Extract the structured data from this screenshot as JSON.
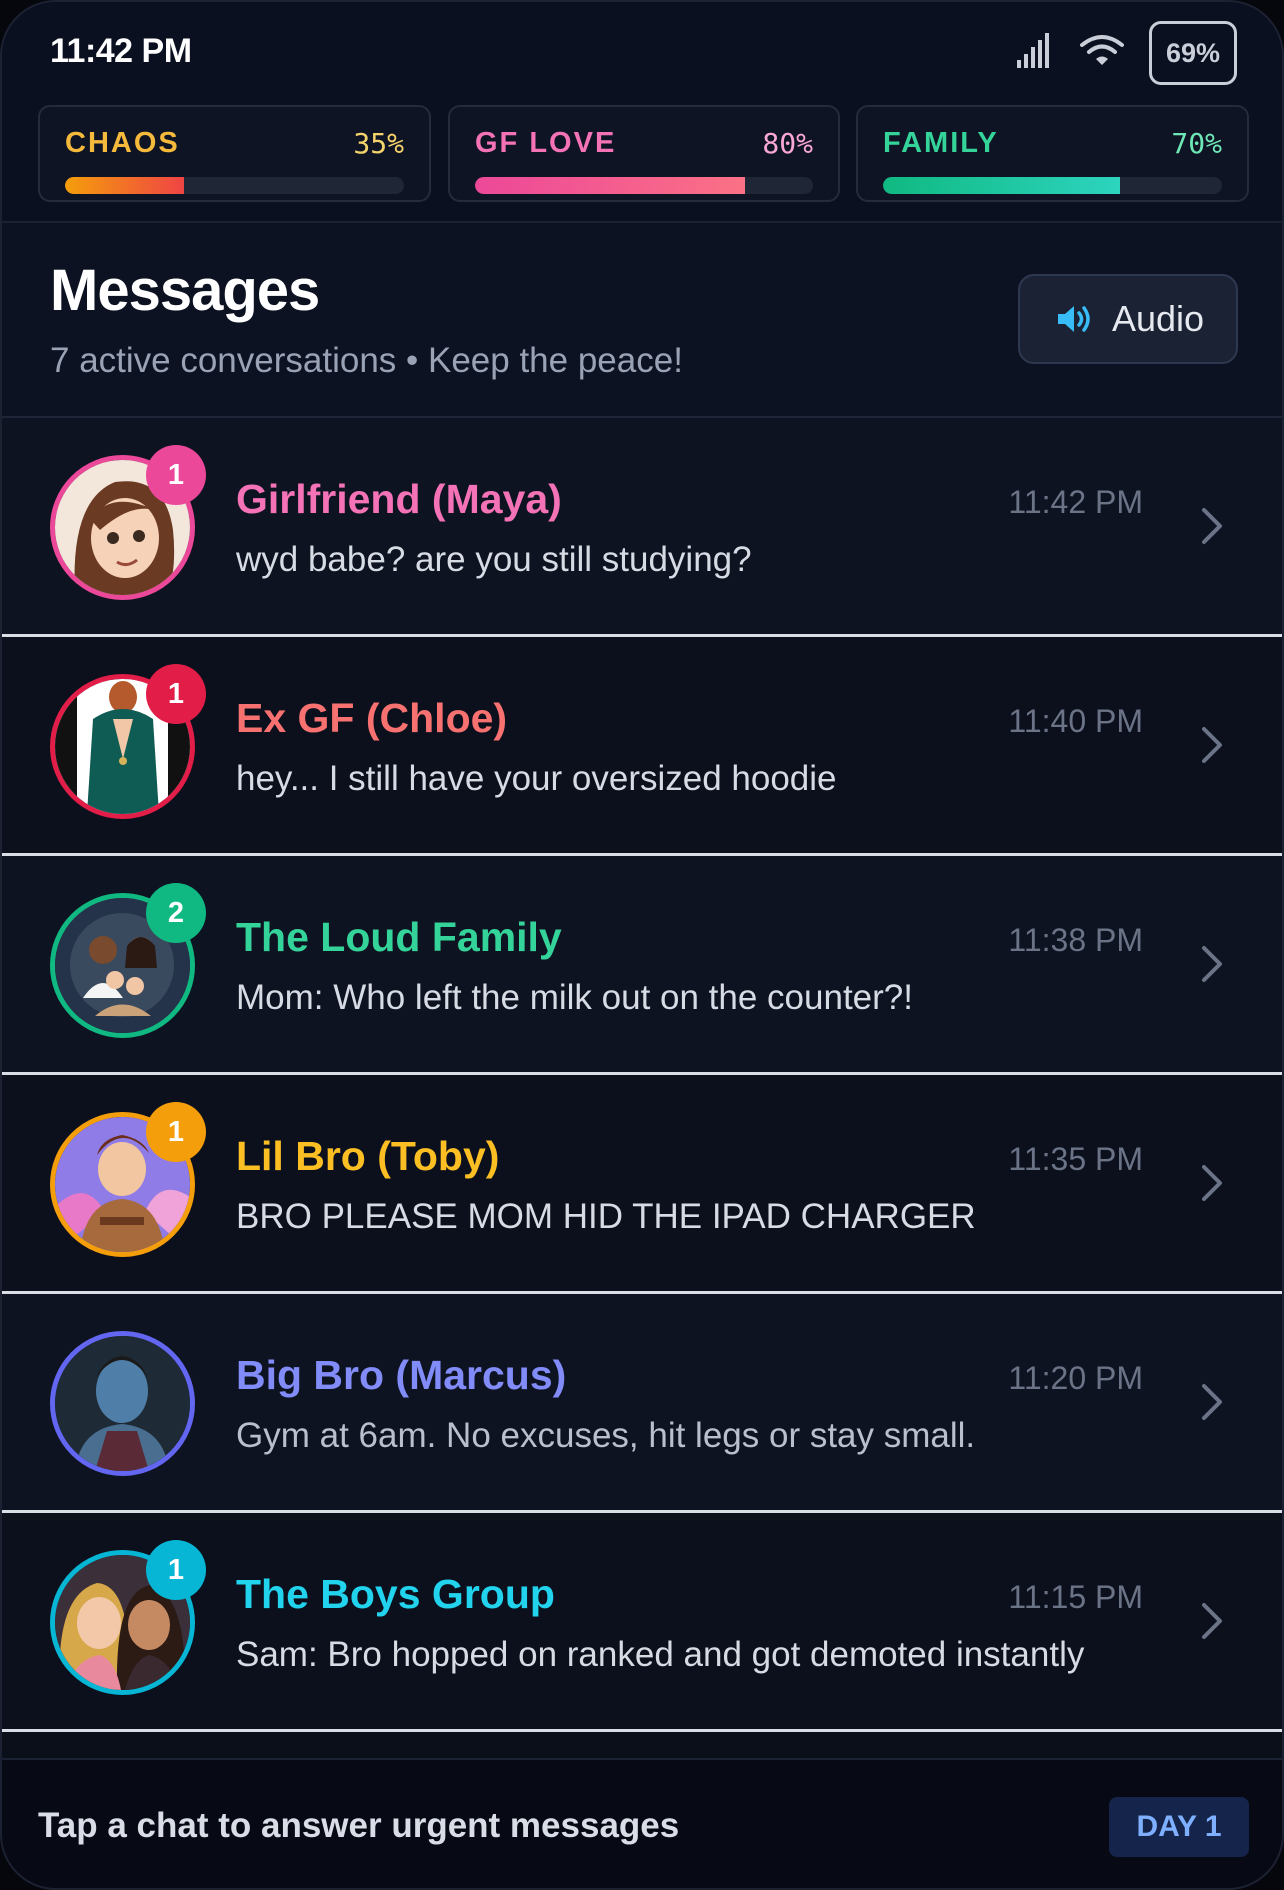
{
  "status_bar": {
    "time": "11:42 PM",
    "battery": "69%",
    "icons": [
      "signal-icon",
      "wifi-icon",
      "battery-icon"
    ]
  },
  "meters": [
    {
      "label": "CHAOS",
      "percent_text": "35%",
      "value": 35,
      "label_color": "#f5b93b",
      "pct_color": "#f5d36b",
      "fill": "linear-gradient(90deg,#f59e0b,#ef4444)"
    },
    {
      "label": "GF LOVE",
      "percent_text": "80%",
      "value": 80,
      "label_color": "#f472b6",
      "pct_color": "#f9a8d4",
      "fill": "linear-gradient(90deg,#ec4899,#fb7185)"
    },
    {
      "label": "FAMILY",
      "percent_text": "70%",
      "value": 70,
      "label_color": "#34d399",
      "pct_color": "#6ee7b7",
      "fill": "linear-gradient(90deg,#10b981,#2dd4bf)"
    }
  ],
  "header": {
    "title": "Messages",
    "subtitle": "7 active conversations • Keep the peace!",
    "audio_label": "Audio",
    "audio_icon": "speaker-icon"
  },
  "chats": [
    {
      "id": "girlfriend-maya",
      "name": "Girlfriend (Maya)",
      "time": "11:42 PM",
      "message": "wyd babe? are you still studying?",
      "badge": "1",
      "name_color": "#f472b6",
      "ring_color": "#ec4899",
      "badge_color": "#ec4899"
    },
    {
      "id": "ex-gf-chloe",
      "name": "Ex GF (Chloe)",
      "time": "11:40 PM",
      "message": "hey... I still have your oversized hoodie",
      "badge": "1",
      "name_color": "#f87171",
      "ring_color": "#e11d48",
      "badge_color": "#e11d48"
    },
    {
      "id": "loud-family",
      "name": "The Loud Family",
      "time": "11:38 PM",
      "message": "Mom: Who left the milk out on the counter?!",
      "badge": "2",
      "name_color": "#34d399",
      "ring_color": "#10b981",
      "badge_color": "#10b981"
    },
    {
      "id": "lil-bro-toby",
      "name": "Lil Bro (Toby)",
      "time": "11:35 PM",
      "message": "BRO PLEASE MOM HID THE IPAD CHARGER",
      "badge": "1",
      "name_color": "#fbbf24",
      "ring_color": "#f59e0b",
      "badge_color": "#f59e0b"
    },
    {
      "id": "big-bro-marcus",
      "name": "Big Bro (Marcus)",
      "time": "11:20 PM",
      "message": "Gym at 6am. No excuses, hit legs or stay small.",
      "badge": "",
      "name_color": "#818cf8",
      "ring_color": "#6366f1",
      "badge_color": "#6366f1"
    },
    {
      "id": "boys-group",
      "name": "The Boys Group",
      "time": "11:15 PM",
      "message": "Sam: Bro hopped on ranked and got demoted instantly",
      "badge": "1",
      "name_color": "#22d3ee",
      "ring_color": "#06b6d4",
      "badge_color": "#06b6d4"
    }
  ],
  "footer": {
    "hint": "Tap a chat to answer urgent messages",
    "day": "DAY 1"
  }
}
